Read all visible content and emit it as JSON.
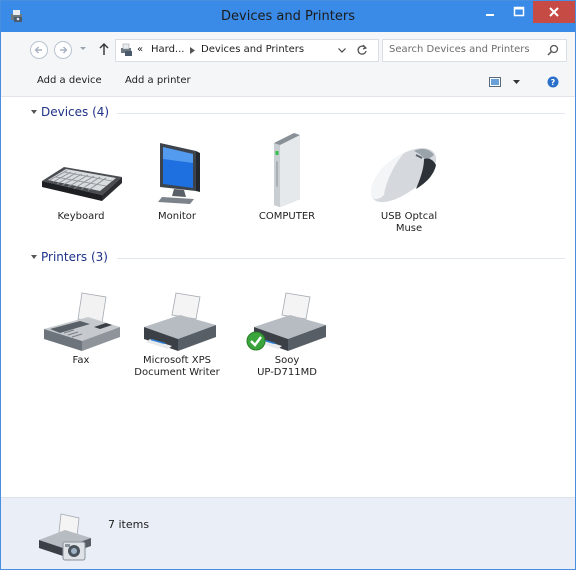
{
  "window": {
    "title": "Devices and Printers",
    "accent": "#3a8be8",
    "close_color": "#c74b45"
  },
  "address": {
    "back_icon": "back-arrow-icon",
    "forward_icon": "forward-arrow-icon",
    "breadcrumb": [
      "«",
      "Hard...",
      "Devices and Printers"
    ],
    "search_placeholder": "Search Devices and Printers"
  },
  "toolbar": {
    "add_device": "Add a device",
    "add_printer": "Add a printer"
  },
  "groups": {
    "devices": {
      "header": "Devices (4)",
      "items": [
        {
          "label": "Keyboard",
          "icon": "keyboard-icon"
        },
        {
          "label": "Monitor",
          "icon": "monitor-icon"
        },
        {
          "label": "COMPUTER",
          "icon": "computer-tower-icon"
        },
        {
          "label": "USB Optcal\nMuse",
          "icon": "mouse-icon"
        }
      ]
    },
    "printers": {
      "header": "Printers (3)",
      "items": [
        {
          "label": "Fax",
          "icon": "fax-icon"
        },
        {
          "label": "Microsoft XPS\nDocument Writer",
          "icon": "printer-icon"
        },
        {
          "label": "Sooy\nUP-D711MD",
          "icon": "printer-default-icon"
        }
      ]
    }
  },
  "status": {
    "count": "7 items"
  }
}
